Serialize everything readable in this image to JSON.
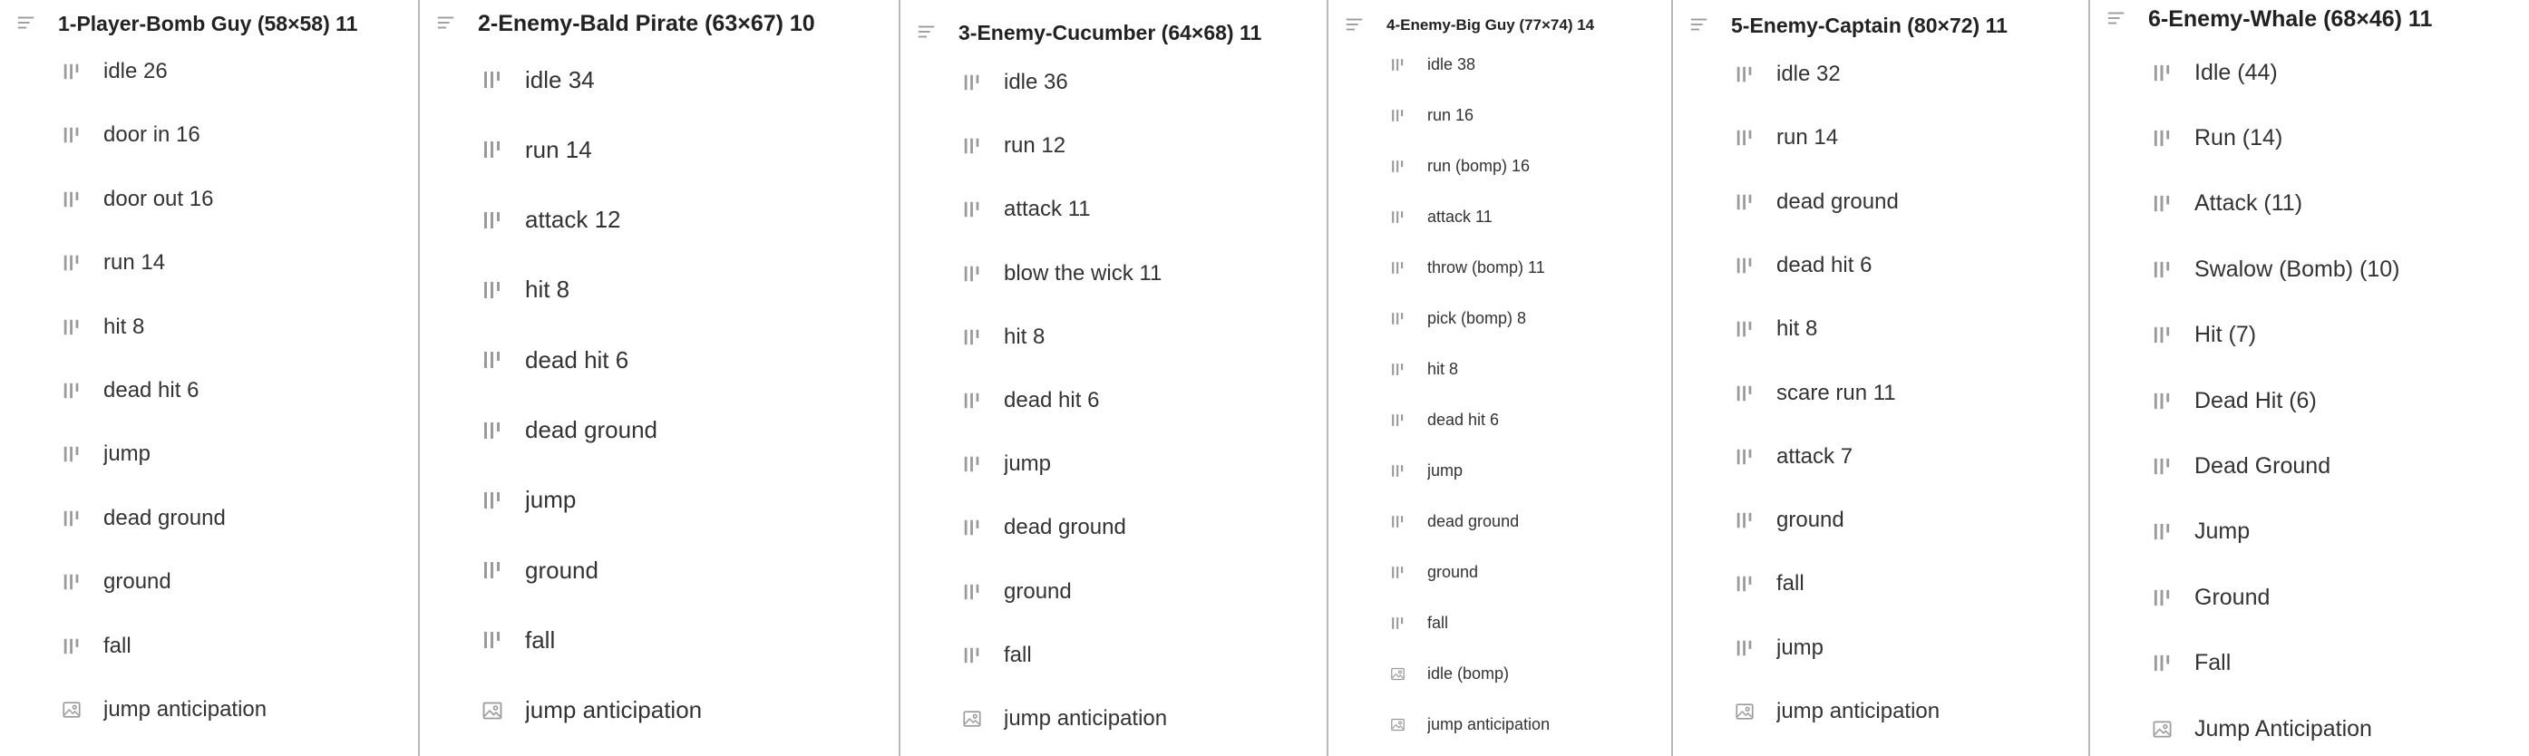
{
  "columns": [
    {
      "title": "1-Player-Bomb Guy (58×58) 11",
      "items": [
        {
          "label": "idle 26",
          "icon": "frames-icon"
        },
        {
          "label": "door in 16",
          "icon": "frames-icon"
        },
        {
          "label": "door out 16",
          "icon": "frames-icon"
        },
        {
          "label": "run 14",
          "icon": "frames-icon"
        },
        {
          "label": "hit 8",
          "icon": "frames-icon"
        },
        {
          "label": "dead hit 6",
          "icon": "frames-icon"
        },
        {
          "label": "jump",
          "icon": "frames-icon"
        },
        {
          "label": "dead ground",
          "icon": "frames-icon"
        },
        {
          "label": "ground",
          "icon": "frames-icon"
        },
        {
          "label": "fall",
          "icon": "frames-icon"
        },
        {
          "label": "jump anticipation",
          "icon": "image-icon"
        }
      ]
    },
    {
      "title": "2-Enemy-Bald Pirate (63×67) 10",
      "items": [
        {
          "label": "idle 34",
          "icon": "frames-icon"
        },
        {
          "label": "run 14",
          "icon": "frames-icon"
        },
        {
          "label": "attack 12",
          "icon": "frames-icon"
        },
        {
          "label": "hit 8",
          "icon": "frames-icon"
        },
        {
          "label": "dead hit 6",
          "icon": "frames-icon"
        },
        {
          "label": "dead ground",
          "icon": "frames-icon"
        },
        {
          "label": "jump",
          "icon": "frames-icon"
        },
        {
          "label": "ground",
          "icon": "frames-icon"
        },
        {
          "label": "fall",
          "icon": "frames-icon"
        },
        {
          "label": "jump anticipation",
          "icon": "image-icon"
        }
      ]
    },
    {
      "title": "3-Enemy-Cucumber (64×68) 11",
      "items": [
        {
          "label": "idle 36",
          "icon": "frames-icon"
        },
        {
          "label": "run 12",
          "icon": "frames-icon"
        },
        {
          "label": "attack 11",
          "icon": "frames-icon"
        },
        {
          "label": "blow the wick 11",
          "icon": "frames-icon"
        },
        {
          "label": "hit 8",
          "icon": "frames-icon"
        },
        {
          "label": "dead hit 6",
          "icon": "frames-icon"
        },
        {
          "label": "jump",
          "icon": "frames-icon"
        },
        {
          "label": "dead ground",
          "icon": "frames-icon"
        },
        {
          "label": "ground",
          "icon": "frames-icon"
        },
        {
          "label": "fall",
          "icon": "frames-icon"
        },
        {
          "label": "jump anticipation",
          "icon": "image-icon"
        }
      ]
    },
    {
      "title": "4-Enemy-Big Guy (77×74) 14",
      "items": [
        {
          "label": "idle 38",
          "icon": "frames-icon"
        },
        {
          "label": "run 16",
          "icon": "frames-icon"
        },
        {
          "label": "run (bomp) 16",
          "icon": "frames-icon"
        },
        {
          "label": "attack 11",
          "icon": "frames-icon"
        },
        {
          "label": "throw (bomp) 11",
          "icon": "frames-icon"
        },
        {
          "label": "pick (bomp) 8",
          "icon": "frames-icon"
        },
        {
          "label": "hit 8",
          "icon": "frames-icon"
        },
        {
          "label": "dead hit 6",
          "icon": "frames-icon"
        },
        {
          "label": "jump",
          "icon": "frames-icon"
        },
        {
          "label": "dead ground",
          "icon": "frames-icon"
        },
        {
          "label": "ground",
          "icon": "frames-icon"
        },
        {
          "label": "fall",
          "icon": "frames-icon"
        },
        {
          "label": "idle (bomp)",
          "icon": "image-icon"
        },
        {
          "label": "jump anticipation",
          "icon": "image-icon"
        }
      ]
    },
    {
      "title": "5-Enemy-Captain (80×72) 11",
      "items": [
        {
          "label": "idle 32",
          "icon": "frames-icon"
        },
        {
          "label": "run 14",
          "icon": "frames-icon"
        },
        {
          "label": "dead ground",
          "icon": "frames-icon"
        },
        {
          "label": "dead hit 6",
          "icon": "frames-icon"
        },
        {
          "label": "hit 8",
          "icon": "frames-icon"
        },
        {
          "label": "scare run 11",
          "icon": "frames-icon"
        },
        {
          "label": "attack 7",
          "icon": "frames-icon"
        },
        {
          "label": "ground",
          "icon": "frames-icon"
        },
        {
          "label": "fall",
          "icon": "frames-icon"
        },
        {
          "label": "jump",
          "icon": "frames-icon"
        },
        {
          "label": "jump anticipation",
          "icon": "image-icon"
        }
      ]
    },
    {
      "title": "6-Enemy-Whale (68×46) 11",
      "items": [
        {
          "label": "Idle (44)",
          "icon": "frames-icon"
        },
        {
          "label": "Run (14)",
          "icon": "frames-icon"
        },
        {
          "label": "Attack (11)",
          "icon": "frames-icon"
        },
        {
          "label": "Swalow (Bomb) (10)",
          "icon": "frames-icon"
        },
        {
          "label": "Hit (7)",
          "icon": "frames-icon"
        },
        {
          "label": "Dead Hit (6)",
          "icon": "frames-icon"
        },
        {
          "label": "Dead Ground",
          "icon": "frames-icon"
        },
        {
          "label": "Jump",
          "icon": "frames-icon"
        },
        {
          "label": "Ground",
          "icon": "frames-icon"
        },
        {
          "label": "Fall",
          "icon": "frames-icon"
        },
        {
          "label": "Jump Anticipation",
          "icon": "image-icon"
        }
      ]
    }
  ]
}
